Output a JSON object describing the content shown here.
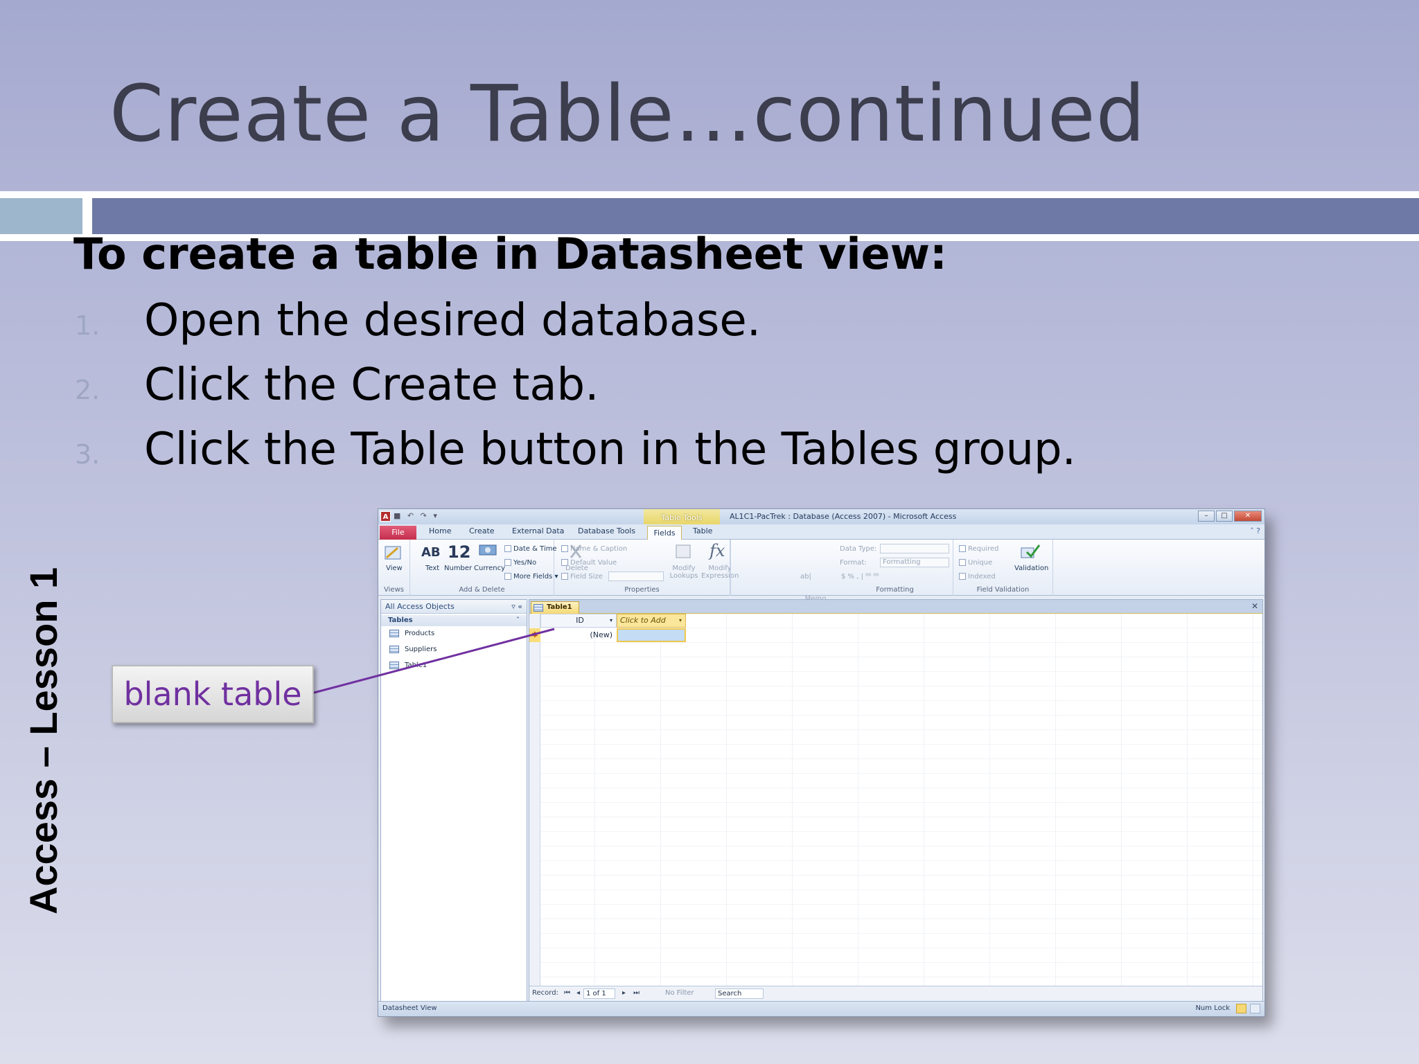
{
  "slide": {
    "title": "Create a Table…continued",
    "heading": "To create a table in Datasheet view:",
    "steps": [
      {
        "num": "1.",
        "text": "Open the desired database."
      },
      {
        "num": "2.",
        "text": "Click the Create tab."
      },
      {
        "num": "3.",
        "text": "Click the Table button in the Tables group."
      }
    ],
    "side_label": "Access – Lesson 1",
    "callout": "blank table",
    "colors": {
      "callout_text": "#7030a0",
      "rule_band": "#6e7aa5",
      "callout_line": "#7030a0"
    }
  },
  "access": {
    "app_icon": "A",
    "qat": "■ ↶ ↷ ▾",
    "context_tab": "Table Tools",
    "window_title": "AL1C1-PacTrek : Database (Access 2007) - Microsoft Access",
    "controls": {
      "minimize": "–",
      "restore": "□",
      "close": "✕"
    },
    "tabs": {
      "file": "File",
      "home": "Home",
      "create": "Create",
      "external": "External Data",
      "dbtools": "Database Tools",
      "fields": "Fields",
      "table": "Table"
    },
    "tab_icons": "˄ ?",
    "ribbon": {
      "views": {
        "view": "View",
        "group": "Views"
      },
      "add_delete": {
        "text_glyph": "AB",
        "text": "Text",
        "number_glyph": "12",
        "number": "Number",
        "currency": "Currency",
        "date_time": "Date & Time",
        "yes_no": "Yes/No",
        "more_fields": "More Fields ▾",
        "delete": "Delete",
        "group": "Add & Delete"
      },
      "properties": {
        "name_caption": "Name & Caption",
        "default_value": "Default Value",
        "field_size": "Field Size",
        "modify_lookups": "Modify Lookups",
        "modify_expression": "Modify Expression",
        "memo_settings": "Memo Settings ▾",
        "fx": "fx",
        "ab": "ab|",
        "group": "Properties"
      },
      "formatting": {
        "data_type": "Data Type:",
        "format": "Format:",
        "format_value": "Formatting",
        "symbols": "$  %  ,  |  ⁰⁰ ⁰⁰",
        "group": "Formatting"
      },
      "validation": {
        "required": "Required",
        "unique": "Unique",
        "indexed": "Indexed",
        "validation": "Validation",
        "group": "Field Validation"
      }
    },
    "nav": {
      "header": "All Access Objects",
      "header_controls": "▿  «",
      "group": "Tables",
      "group_control": "˄",
      "items": [
        "Products",
        "Suppliers",
        "Table1"
      ]
    },
    "document": {
      "tab": "Table1",
      "close": "✕",
      "columns": [
        "ID",
        "Click to Add"
      ],
      "dropdown": "▾",
      "new_marker": "✱",
      "new_value": "(New)"
    },
    "record_nav": {
      "label": "Record:",
      "first": "⏮",
      "prev": "◂",
      "position": "1 of 1",
      "next": "▸",
      "last": "⏭",
      "filter": "No Filter",
      "search": "Search"
    },
    "status": {
      "left": "Datasheet View",
      "right": "Num Lock"
    }
  }
}
